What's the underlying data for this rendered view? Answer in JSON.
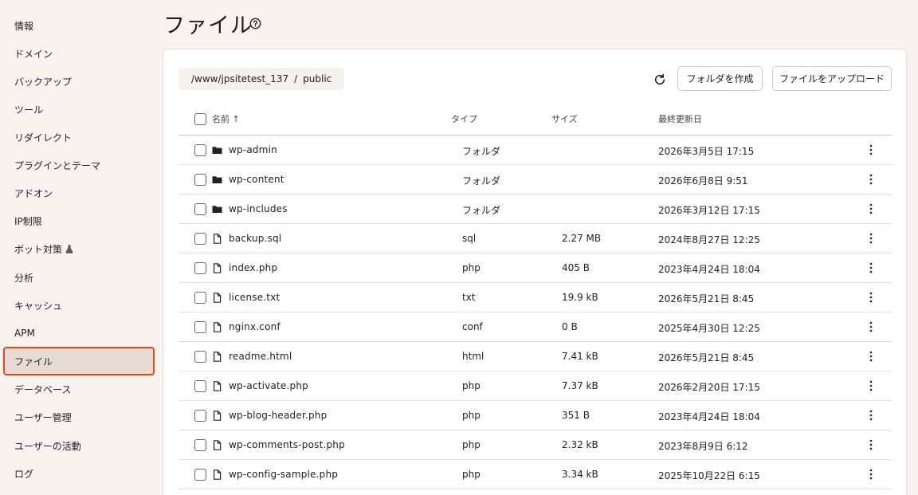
{
  "sidebar": {
    "items": [
      {
        "label": "情報"
      },
      {
        "label": "ドメイン"
      },
      {
        "label": "バックアップ"
      },
      {
        "label": "ツール"
      },
      {
        "label": "リダイレクト"
      },
      {
        "label": "プラグインとテーマ"
      },
      {
        "label": "アドオン"
      },
      {
        "label": "IP制限"
      },
      {
        "label": "ボット対策"
      },
      {
        "label": "分析"
      },
      {
        "label": "キャッシュ"
      },
      {
        "label": "APM"
      },
      {
        "label": "ファイル"
      },
      {
        "label": "データベース"
      },
      {
        "label": "ユーザー管理"
      },
      {
        "label": "ユーザーの活動"
      },
      {
        "label": "ログ"
      }
    ],
    "active_index": 12,
    "beta_icon": "flask-icon"
  },
  "header": {
    "title": "ファイル",
    "help_icon": "question-circle-icon"
  },
  "toolbar": {
    "breadcrumb": {
      "path": "/www/jpsitetest_137",
      "separator": "/",
      "current": "public"
    },
    "refresh_icon": "refresh-icon",
    "create_folder_label": "フォルダを作成",
    "upload_label": "ファイルをアップロード"
  },
  "table": {
    "columns": {
      "name": "名前 ↑",
      "type": "タイプ",
      "size": "サイズ",
      "modified": "最終更新日"
    },
    "rows": [
      {
        "name": "wp-admin",
        "type": "フォルダ",
        "size": "",
        "modified": "2026年3月5日 17:15",
        "icon": "folder-icon"
      },
      {
        "name": "wp-content",
        "type": "フォルダ",
        "size": "",
        "modified": "2026年6月8日 9:51",
        "icon": "folder-icon"
      },
      {
        "name": "wp-includes",
        "type": "フォルダ",
        "size": "",
        "modified": "2026年3月12日 17:15",
        "icon": "folder-icon"
      },
      {
        "name": "backup.sql",
        "type": "sql",
        "size": "2.27 MB",
        "modified": "2024年8月27日 12:25",
        "icon": "file-icon"
      },
      {
        "name": "index.php",
        "type": "php",
        "size": "405 B",
        "modified": "2023年4月24日 18:04",
        "icon": "file-icon"
      },
      {
        "name": "license.txt",
        "type": "txt",
        "size": "19.9 kB",
        "modified": "2026年5月21日 8:45",
        "icon": "file-icon"
      },
      {
        "name": "nginx.conf",
        "type": "conf",
        "size": "0 B",
        "modified": "2025年4月30日 12:25",
        "icon": "file-icon"
      },
      {
        "name": "readme.html",
        "type": "html",
        "size": "7.41 kB",
        "modified": "2026年5月21日 8:45",
        "icon": "file-icon"
      },
      {
        "name": "wp-activate.php",
        "type": "php",
        "size": "7.37 kB",
        "modified": "2026年2月20日 17:15",
        "icon": "file-icon"
      },
      {
        "name": "wp-blog-header.php",
        "type": "php",
        "size": "351 B",
        "modified": "2023年4月24日 18:04",
        "icon": "file-icon"
      },
      {
        "name": "wp-comments-post.php",
        "type": "php",
        "size": "2.32 kB",
        "modified": "2023年8月9日 6:12",
        "icon": "file-icon"
      },
      {
        "name": "wp-config-sample.php",
        "type": "php",
        "size": "3.34 kB",
        "modified": "2025年10月22日 6:15",
        "icon": "file-icon"
      }
    ]
  },
  "colors": {
    "active_outline": "#f0441a",
    "active_bg": "#e5dbd3",
    "page_bg": "#f7f3ef"
  }
}
